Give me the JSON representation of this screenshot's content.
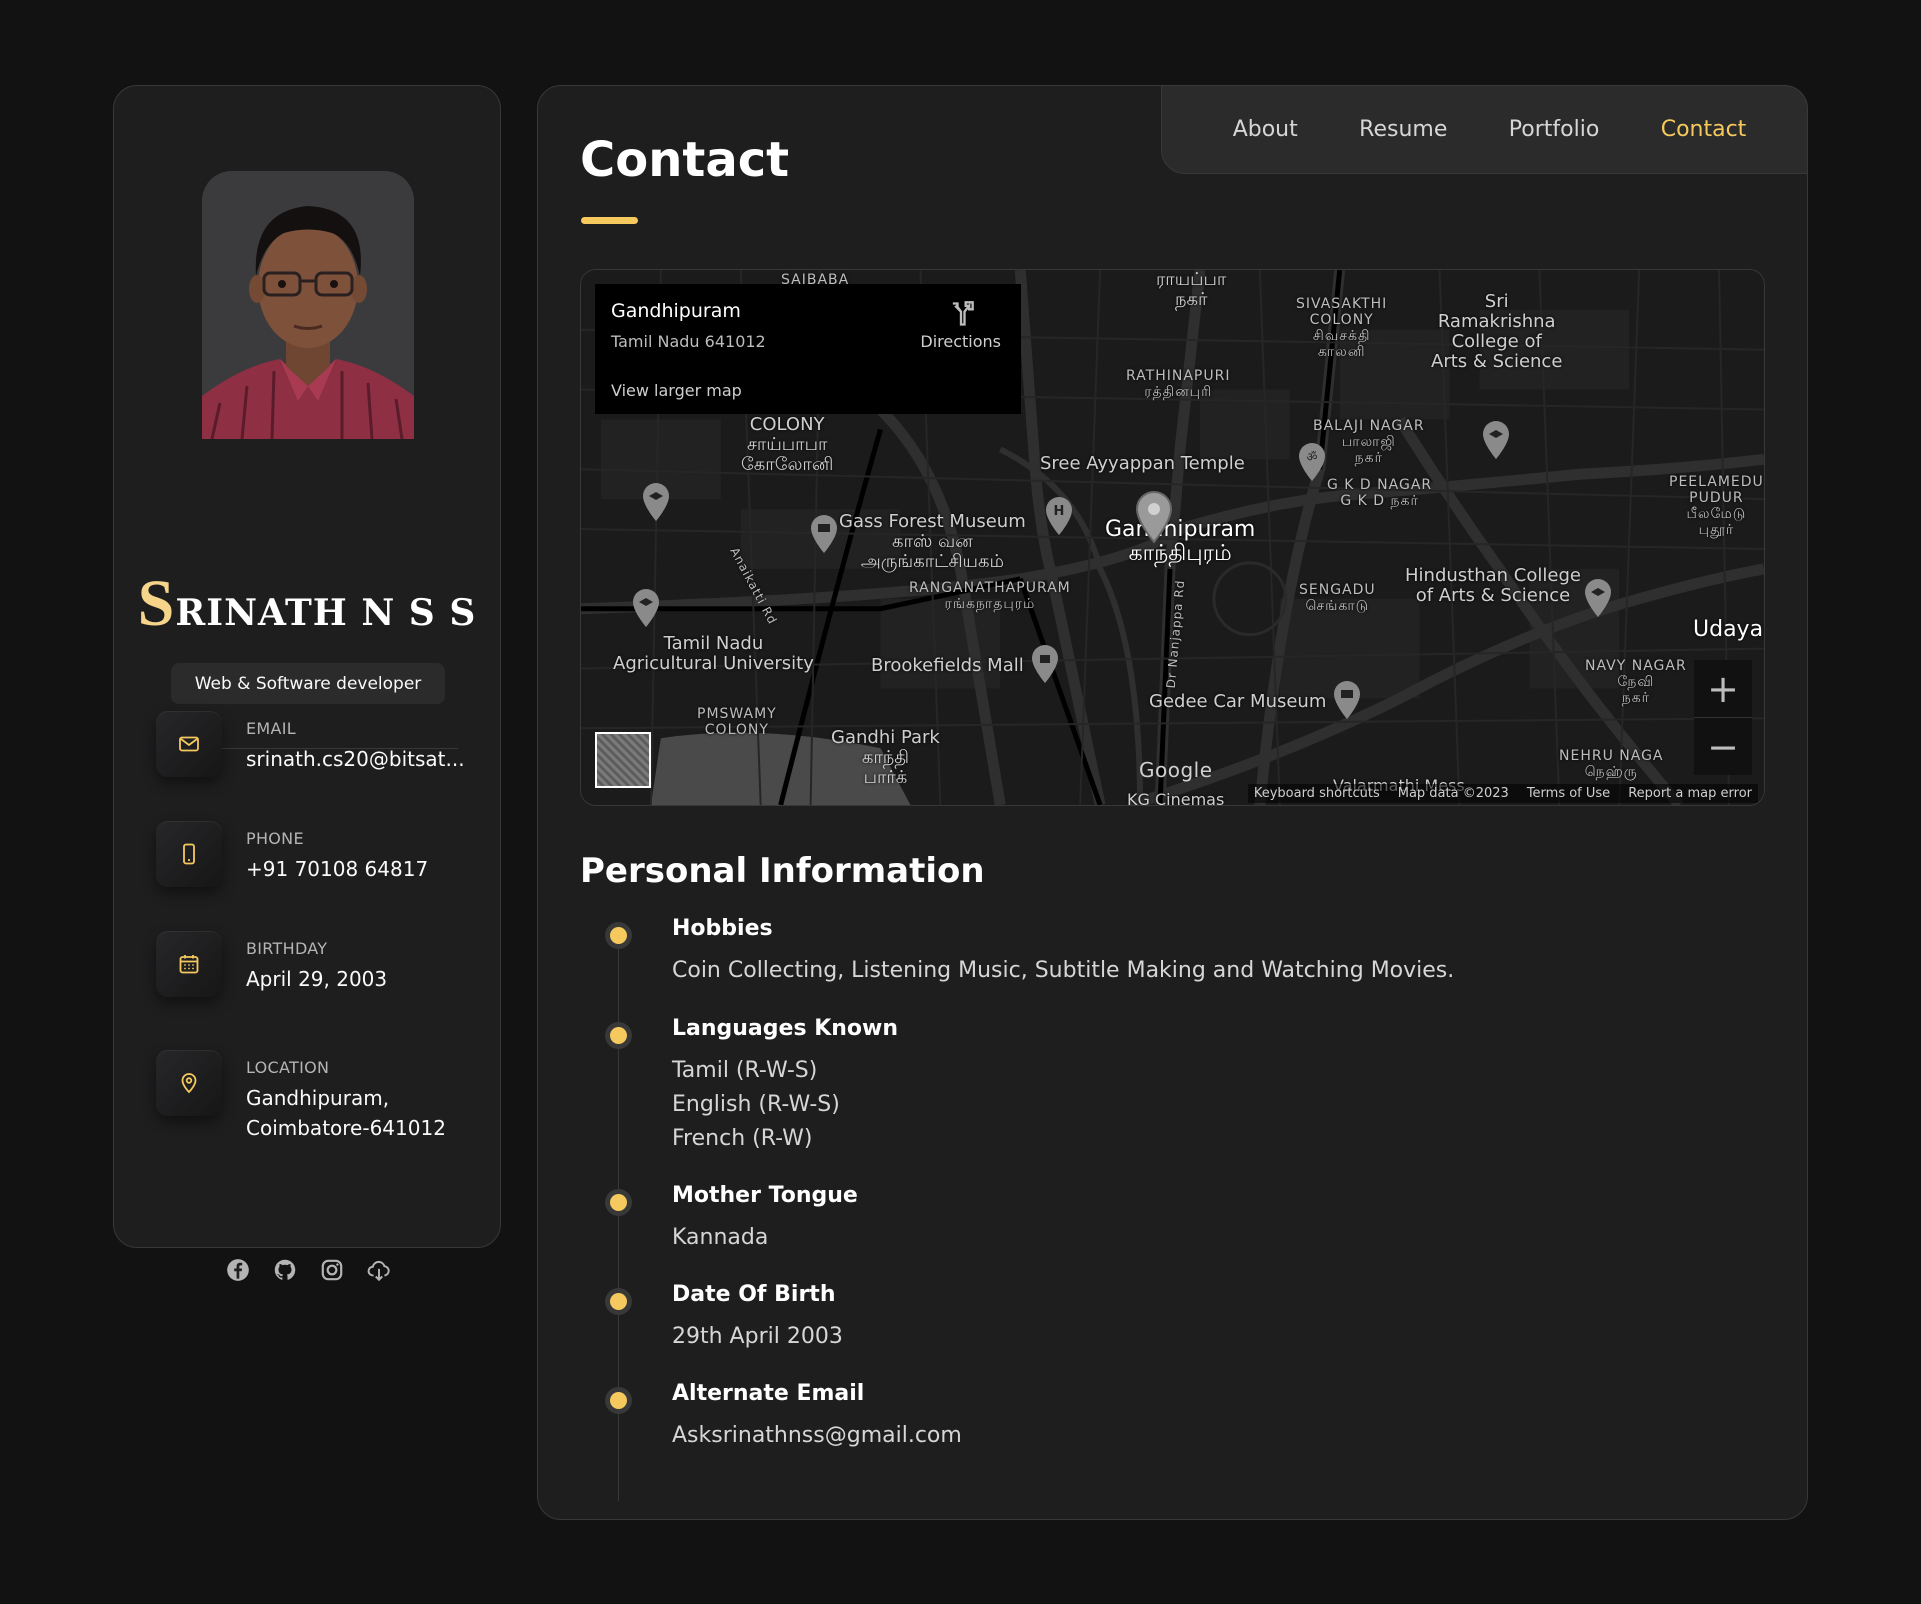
{
  "sidebar": {
    "name_first": "S",
    "name_rest": "RINATH N S S",
    "role": "Web & Software developer",
    "contacts": [
      {
        "label": "Email",
        "value": "srinath.cs20@bitsat..."
      },
      {
        "label": "Phone",
        "value": "+91 70108 64817"
      },
      {
        "label": "Birthday",
        "value": "April 29, 2003"
      },
      {
        "label": "Location",
        "value": "Gandhipuram,\nCoimbatore-641012"
      }
    ],
    "social_icons": [
      "facebook-icon",
      "github-icon",
      "instagram-icon",
      "cloud-download-icon"
    ]
  },
  "nav": {
    "items": [
      "About",
      "Resume",
      "Portfolio",
      "Contact"
    ],
    "active": "Contact"
  },
  "main": {
    "title": "Contact",
    "map": {
      "place_name": "Gandhipuram",
      "place_address": "Tamil Nadu 641012",
      "directions": "Directions",
      "view_larger": "View larger map",
      "zoom_in": "+",
      "zoom_out": "−",
      "logo": "Google",
      "footer": [
        "Keyboard shortcuts",
        "Map data ©2023",
        "Terms of Use",
        "Report a map error"
      ],
      "labels": [
        "SAIBABA",
        "ராயப்பா\nநகர்",
        "SIVASAKTHI\nCOLONY\nசிவசக்தி\nகாலனி",
        "Sri\nRamakrishna\nCollege of\nArts & Science",
        "RATHINAPURI\nரத்தினபுரி",
        "BALAJI NAGAR\nபாலாஜி\nநகர்",
        "COLONY\nசாய்பாபா\nகோலோனி",
        "Sree Ayyappan Temple",
        "G K D NAGAR\nG K D நகர்",
        "PEELAMEDU\nPUDUR\nபீலமேடு\nபுதூர்",
        "Gass Forest Museum\nகாஸ் வன\nஅருங்காட்சியகம்",
        "Gandhipuram\nகாந்திபுரம்",
        "RANGANATHAPURAM\nரங்கநாதபுரம்",
        "SENGADU\nசெங்காடு",
        "Hindusthan College\nof Arts & Science",
        "Tamil Nadu\nAgricultural University",
        "Brookefields Mall",
        "Udaya",
        "NAVY NAGAR\nநேவி\nநகர்",
        "Gedee Car Museum",
        "PMSWAMY\nCOLONY",
        "Gandhi Park\nகாந்தி\nபார்க்",
        "NEHRU NAGA\nநெஹ்ரு",
        "Valarmathi Mess",
        "KG Cinemas",
        "Dr Nanjappa Rd",
        "Anaikatti Rd"
      ]
    },
    "personal": {
      "title": "Personal Information",
      "items": [
        {
          "title": "Hobbies",
          "text": "Coin Collecting, Listening Music, Subtitle Making and Watching Movies."
        },
        {
          "title": "Languages Known",
          "text": "Tamil (R-W-S)\nEnglish (R-W-S)\nFrench (R-W)"
        },
        {
          "title": "Mother Tongue",
          "text": "Kannada"
        },
        {
          "title": "Date Of Birth",
          "text": "29th April 2003"
        },
        {
          "title": "Alternate Email",
          "text": "Asksrinathnss@gmail.com"
        }
      ]
    }
  },
  "colors": {
    "accent": "#f6c95e",
    "background": "#121212",
    "card": "#1e1e1f"
  }
}
